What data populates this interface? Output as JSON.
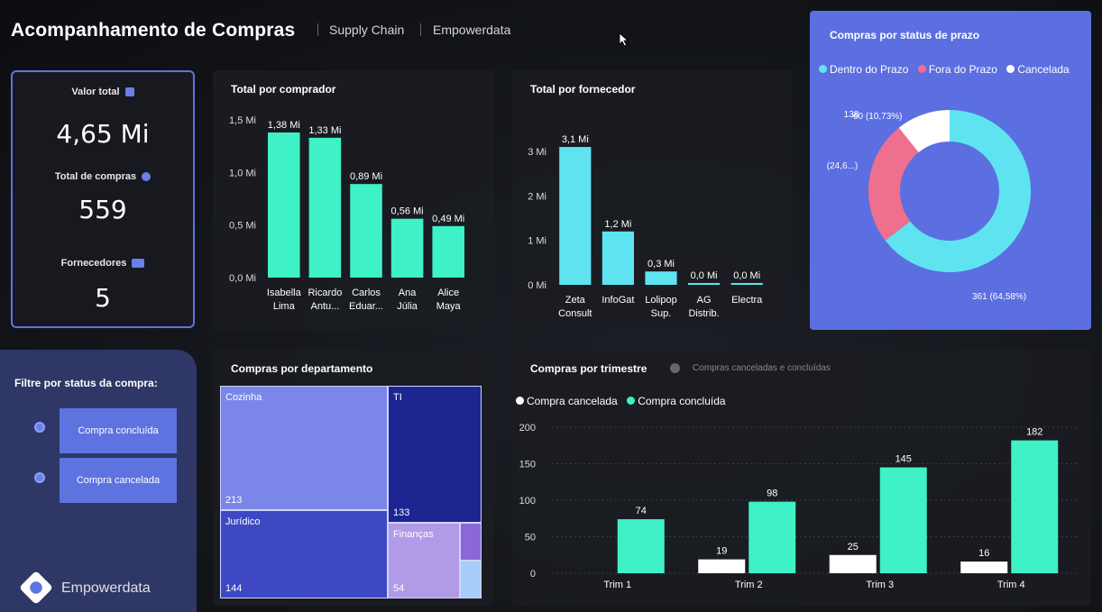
{
  "header": {
    "title": "Acompanhamento de Compras",
    "crumb1": "Supply Chain",
    "crumb2": "Empowerdata"
  },
  "kpis": {
    "valor_label": "Valor total",
    "valor": "4,65 Mi",
    "compras_label": "Total de compras",
    "compras": "559",
    "fornecedores_label": "Fornecedores",
    "fornecedores": "5"
  },
  "filter": {
    "title": "Filtre por status da compra:",
    "option1": "Compra concluída",
    "option2": "Compra cancelada",
    "brand": "Empowerdata"
  },
  "colors": {
    "accent": "#3ef1c6",
    "cyan": "#5fe3f0",
    "donut_blue": "#5fe3f0",
    "donut_pink": "#ef6f8f",
    "donut_white": "#ffffff",
    "panel_blue": "#5b6fe0"
  },
  "chart_data": [
    {
      "id": "comprador",
      "type": "bar",
      "title": "Total por comprador",
      "categories": [
        [
          "Isabella",
          "Lima"
        ],
        [
          "Ricardo",
          "Antu..."
        ],
        [
          "Carlos",
          "Eduar..."
        ],
        [
          "Ana",
          "Júlia"
        ],
        [
          "Alice",
          "Maya"
        ]
      ],
      "values": [
        1.38,
        1.33,
        0.89,
        0.56,
        0.49
      ],
      "data_labels": [
        "1,38 Mi",
        "1,33 Mi",
        "0,89 Mi",
        "0,56 Mi",
        "0,49 Mi"
      ],
      "yticks": [
        "0,0 Mi",
        "0,5 Mi",
        "1,0 Mi",
        "1,5 Mi"
      ],
      "ylim": [
        0,
        1.5
      ]
    },
    {
      "id": "fornecedor",
      "type": "bar",
      "title": "Total por fornecedor",
      "categories": [
        [
          "Zeta",
          "Consult"
        ],
        [
          "InfoGat"
        ],
        [
          "Lolipop",
          "Sup."
        ],
        [
          "AG",
          "Distrib."
        ],
        [
          "Electra"
        ]
      ],
      "values": [
        3.1,
        1.2,
        0.3,
        0.0,
        0.0
      ],
      "data_labels": [
        "3,1 Mi",
        "1,2 Mi",
        "0,3 Mi",
        "0,0 Mi",
        "0,0 Mi"
      ],
      "yticks": [
        "0 Mi",
        "1 Mi",
        "2 Mi",
        "3 Mi"
      ],
      "ylim": [
        0,
        3
      ]
    },
    {
      "id": "prazo",
      "type": "pie",
      "title": "Compras por status de prazo",
      "legend": [
        "Dentro do Prazo",
        "Fora do Prazo",
        "Cancelada"
      ],
      "values": [
        361,
        138,
        60
      ],
      "data_labels": [
        "361 (64,58%)",
        "138 (24,6...)",
        "60 (10,73%)"
      ]
    },
    {
      "id": "departamento",
      "type": "heatmap",
      "title": "Compras por departamento",
      "cells": [
        {
          "label": "Cozinha",
          "value": "213",
          "color": "#7a86e8"
        },
        {
          "label": "TI",
          "value": "133",
          "color": "#1c2590"
        },
        {
          "label": "Jurídico",
          "value": "144",
          "color": "#3d48c2"
        },
        {
          "label": "Finanças",
          "value": "54",
          "color": "#b19ae6"
        },
        {
          "label": "",
          "value": "",
          "color": "#8a68d6"
        },
        {
          "label": "",
          "value": "",
          "color": "#a8cdfa"
        }
      ]
    },
    {
      "id": "trimestre",
      "type": "bar",
      "title": "Compras por trimestre",
      "subtitle": "Compras canceladas e concluídas",
      "categories": [
        "Trim 1",
        "Trim 2",
        "Trim 3",
        "Trim 4"
      ],
      "series": [
        {
          "name": "Compra cancelada",
          "values": [
            null,
            19,
            25,
            16
          ],
          "color": "#ffffff"
        },
        {
          "name": "Compra concluída",
          "values": [
            74,
            98,
            145,
            182
          ],
          "color": "#3ef1c6"
        }
      ],
      "yticks": [
        "0",
        "50",
        "100",
        "150",
        "200"
      ],
      "ylim": [
        0,
        200
      ]
    }
  ]
}
